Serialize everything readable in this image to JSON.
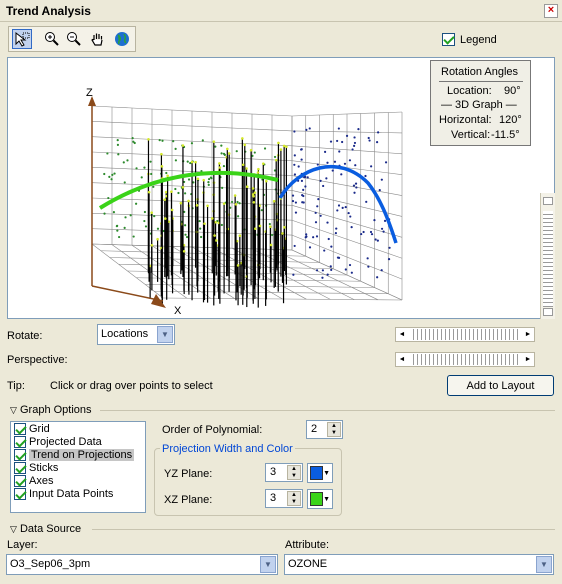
{
  "window": {
    "title": "Trend Analysis",
    "close": "×"
  },
  "toolbar": {
    "icons": [
      "select-pointer-icon",
      "zoom-in-icon",
      "zoom-out-icon",
      "pan-hand-icon",
      "globe-icon"
    ]
  },
  "legend": {
    "label": "Legend",
    "checked": true
  },
  "plot": {
    "axis_z": "Z",
    "axis_x": "X",
    "trend_colors": {
      "yz": "#0a5de0",
      "xz": "#3ad318",
      "points_xz": "#2c8a2c",
      "points_yz": "#1a2a8a",
      "sticks": "#000000",
      "stick_tips": "#d4e82a"
    }
  },
  "rotation": {
    "title": "Rotation Angles",
    "location_label": "Location:",
    "location_value": "90°",
    "graph_label": "— 3D Graph —",
    "horizontal_label": "Horizontal:",
    "horizontal_value": "120°",
    "vertical_label": "Vertical:",
    "vertical_value": "-11.5°"
  },
  "controls": {
    "rotate_label": "Rotate:",
    "rotate_value": "Locations",
    "perspective_label": "Perspective:",
    "tip_label": "Tip:",
    "tip_text": "Click or drag over points to select",
    "add_layout": "Add to Layout"
  },
  "graph_options": {
    "header": "Graph Options",
    "items": [
      {
        "label": "Grid",
        "checked": true
      },
      {
        "label": "Projected Data",
        "checked": true
      },
      {
        "label": "Trend on Projections",
        "checked": true,
        "selected": true
      },
      {
        "label": "Sticks",
        "checked": true
      },
      {
        "label": "Axes",
        "checked": true
      },
      {
        "label": "Input Data Points",
        "checked": true
      }
    ],
    "order_label": "Order of Polynomial:",
    "order_value": "2",
    "projection_header": "Projection Width and Color",
    "yz_label": "YZ Plane:",
    "yz_value": "3",
    "yz_color": "#0a5de0",
    "xz_label": "XZ Plane:",
    "xz_value": "3",
    "xz_color": "#3ad318"
  },
  "data_source": {
    "header": "Data Source",
    "layer_label": "Layer:",
    "layer_value": "O3_Sep06_3pm",
    "attribute_label": "Attribute:",
    "attribute_value": "OZONE"
  }
}
